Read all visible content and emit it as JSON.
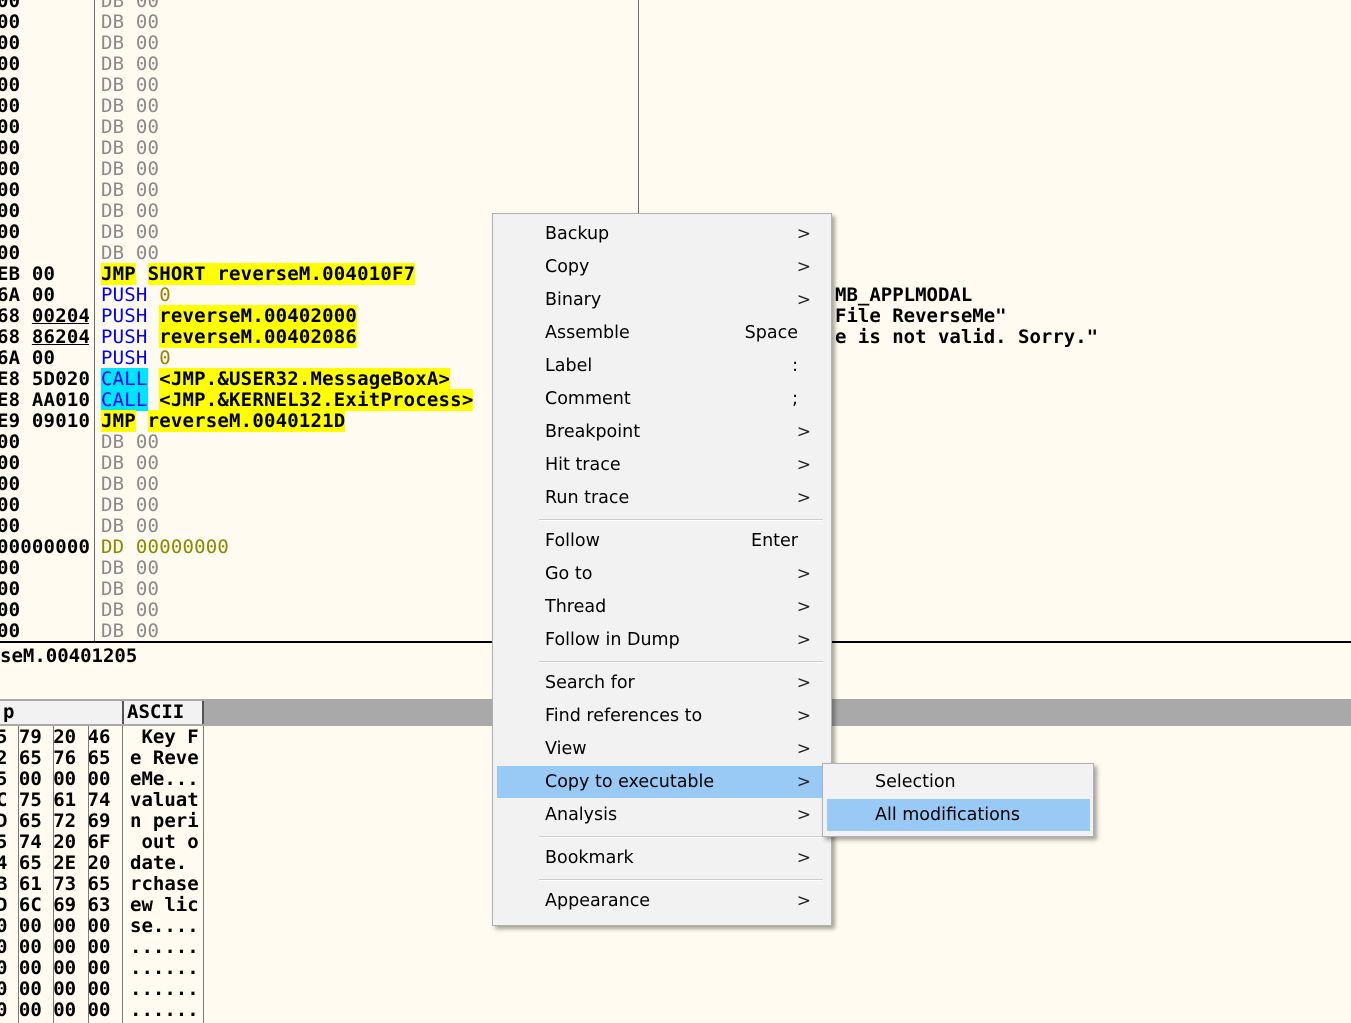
{
  "disasm": {
    "rows": [
      {
        "hex": "00",
        "mn": "DB",
        "mn_style": "db",
        "arg": "00",
        "arg_style": "gray"
      },
      {
        "hex": "00",
        "mn": "DB",
        "mn_style": "db",
        "arg": "00",
        "arg_style": "gray"
      },
      {
        "hex": "00",
        "mn": "DB",
        "mn_style": "db",
        "arg": "00",
        "arg_style": "gray"
      },
      {
        "hex": "00",
        "mn": "DB",
        "mn_style": "db",
        "arg": "00",
        "arg_style": "gray"
      },
      {
        "hex": "00",
        "mn": "DB",
        "mn_style": "db",
        "arg": "00",
        "arg_style": "gray"
      },
      {
        "hex": "00",
        "mn": "DB",
        "mn_style": "db",
        "arg": "00",
        "arg_style": "gray"
      },
      {
        "hex": "00",
        "mn": "DB",
        "mn_style": "db",
        "arg": "00",
        "arg_style": "gray"
      },
      {
        "hex": "00",
        "mn": "DB",
        "mn_style": "db",
        "arg": "00",
        "arg_style": "gray"
      },
      {
        "hex": "00",
        "mn": "DB",
        "mn_style": "db",
        "arg": "00",
        "arg_style": "gray"
      },
      {
        "hex": "00",
        "mn": "DB",
        "mn_style": "db",
        "arg": "00",
        "arg_style": "gray"
      },
      {
        "hex": "00",
        "mn": "DB",
        "mn_style": "db",
        "arg": "00",
        "arg_style": "gray"
      },
      {
        "hex": "00",
        "mn": "DB",
        "mn_style": "db",
        "arg": "00",
        "arg_style": "gray"
      },
      {
        "hex": "00",
        "mn": "DB",
        "mn_style": "db",
        "arg": "00",
        "arg_style": "gray"
      },
      {
        "hex": "EB 00",
        "mn": "JMP",
        "mn_style": "jmp",
        "arg": "SHORT reverseM.004010F7",
        "arg_style": "hl"
      },
      {
        "hex": "6A 00",
        "mn": "PUSH",
        "mn_style": "push",
        "arg": "0",
        "arg_style": "num"
      },
      {
        "hex": "68 00204",
        "mn": "PUSH",
        "mn_style": "push",
        "arg": "reverseM.00402000",
        "arg_style": "hl",
        "u": true
      },
      {
        "hex": "68 86204",
        "mn": "PUSH",
        "mn_style": "push",
        "arg": "reverseM.00402086",
        "arg_style": "hl",
        "u": true
      },
      {
        "hex": "6A 00",
        "mn": "PUSH",
        "mn_style": "push",
        "arg": "0",
        "arg_style": "num"
      },
      {
        "hex": "E8 5D020",
        "mn": "CALL",
        "mn_style": "call",
        "arg": "<JMP.&USER32.MessageBoxA>",
        "arg_style": "hl"
      },
      {
        "hex": "E8 AA010",
        "mn": "CALL",
        "mn_style": "call",
        "arg": "<JMP.&KERNEL32.ExitProcess>",
        "arg_style": "hl"
      },
      {
        "hex": "E9 09010",
        "mn": "JMP",
        "mn_style": "jmp",
        "arg": "reverseM.0040121D",
        "arg_style": "hl"
      },
      {
        "hex": "00",
        "mn": "DB",
        "mn_style": "db",
        "arg": "00",
        "arg_style": "gray"
      },
      {
        "hex": "00",
        "mn": "DB",
        "mn_style": "db",
        "arg": "00",
        "arg_style": "gray"
      },
      {
        "hex": "00",
        "mn": "DB",
        "mn_style": "db",
        "arg": "00",
        "arg_style": "gray"
      },
      {
        "hex": "00",
        "mn": "DB",
        "mn_style": "db",
        "arg": "00",
        "arg_style": "gray"
      },
      {
        "hex": "00",
        "mn": "DB",
        "mn_style": "db",
        "arg": "00",
        "arg_style": "gray"
      },
      {
        "hex": "00000000",
        "mn": "DD",
        "mn_style": "dd",
        "arg": "00000000",
        "arg_style": "dd"
      },
      {
        "hex": "00",
        "mn": "DB",
        "mn_style": "db",
        "arg": "00",
        "arg_style": "gray"
      },
      {
        "hex": "00",
        "mn": "DB",
        "mn_style": "db",
        "arg": "00",
        "arg_style": "gray"
      },
      {
        "hex": "00",
        "mn": "DB",
        "mn_style": "db",
        "arg": "00",
        "arg_style": "gray"
      },
      {
        "hex": "00",
        "mn": "DB",
        "mn_style": "db",
        "arg": "00",
        "arg_style": "gray"
      }
    ],
    "comments": [
      {
        "row": 14,
        "text": "MB_APPLMODAL"
      },
      {
        "row": 15,
        "text": "File ReverseMe\""
      },
      {
        "row": 16,
        "text": "e is not valid. Sorry.\""
      }
    ]
  },
  "info_line": "seM.00401205",
  "dump": {
    "col_hex": "p",
    "col_ascii": "ASCII",
    "rows": [
      {
        "hex": "5 79 20 46",
        "ascii": " Key F"
      },
      {
        "hex": "2 65 76 65",
        "ascii": "e Reve"
      },
      {
        "hex": "5 00 00 00",
        "ascii": "eMe..."
      },
      {
        "hex": "C 75 61 74",
        "ascii": "valuat"
      },
      {
        "hex": "D 65 72 69",
        "ascii": "n peri"
      },
      {
        "hex": "5 74 20 6F",
        "ascii": " out o"
      },
      {
        "hex": "4 65 2E 20",
        "ascii": "date. "
      },
      {
        "hex": "B 61 73 65",
        "ascii": "rchase"
      },
      {
        "hex": "D 6C 69 63",
        "ascii": "ew lic"
      },
      {
        "hex": "0 00 00 00",
        "ascii": "se...."
      },
      {
        "hex": "0 00 00 00",
        "ascii": "......"
      },
      {
        "hex": "0 00 00 00",
        "ascii": "......"
      },
      {
        "hex": "0 00 00 00",
        "ascii": "......"
      },
      {
        "hex": "0 00 00 00",
        "ascii": "......"
      }
    ]
  },
  "context_menu": {
    "items": [
      {
        "label": "Backup",
        "shortcut": "",
        "submenu": true
      },
      {
        "label": "Copy",
        "shortcut": "",
        "submenu": true
      },
      {
        "label": "Binary",
        "shortcut": "",
        "submenu": true
      },
      {
        "label": "Assemble",
        "shortcut": "Space",
        "submenu": false
      },
      {
        "label": "Label",
        "shortcut": ":",
        "submenu": false
      },
      {
        "label": "Comment",
        "shortcut": ";",
        "submenu": false
      },
      {
        "label": "Breakpoint",
        "shortcut": "",
        "submenu": true
      },
      {
        "label": "Hit trace",
        "shortcut": "",
        "submenu": true
      },
      {
        "label": "Run trace",
        "shortcut": "",
        "submenu": true
      },
      {
        "label": "Follow",
        "shortcut": "Enter",
        "submenu": false
      },
      {
        "label": "Go to",
        "shortcut": "",
        "submenu": true
      },
      {
        "label": "Thread",
        "shortcut": "",
        "submenu": true
      },
      {
        "label": "Follow in Dump",
        "shortcut": "",
        "submenu": true
      },
      {
        "label": "Search for",
        "shortcut": "",
        "submenu": true
      },
      {
        "label": "Find references to",
        "shortcut": "",
        "submenu": true
      },
      {
        "label": "View",
        "shortcut": "",
        "submenu": true
      },
      {
        "label": "Copy to executable",
        "shortcut": "",
        "submenu": true,
        "highlighted": true
      },
      {
        "label": "Analysis",
        "shortcut": "",
        "submenu": true
      },
      {
        "label": "Bookmark",
        "shortcut": "",
        "submenu": true
      },
      {
        "label": "Appearance",
        "shortcut": "",
        "submenu": true
      }
    ],
    "arrow_glyph": ">"
  },
  "submenu": {
    "items": [
      {
        "label": "Selection"
      },
      {
        "label": "All modifications",
        "highlighted": true
      }
    ]
  },
  "colors": {
    "background": "#fffbf0",
    "highlight_yellow": "#ffff00",
    "call_cyan": "#00e5ff",
    "push_blue": "#0000ff",
    "menu_bg": "#f2f2f2",
    "menu_highlight": "#99c9f5"
  }
}
